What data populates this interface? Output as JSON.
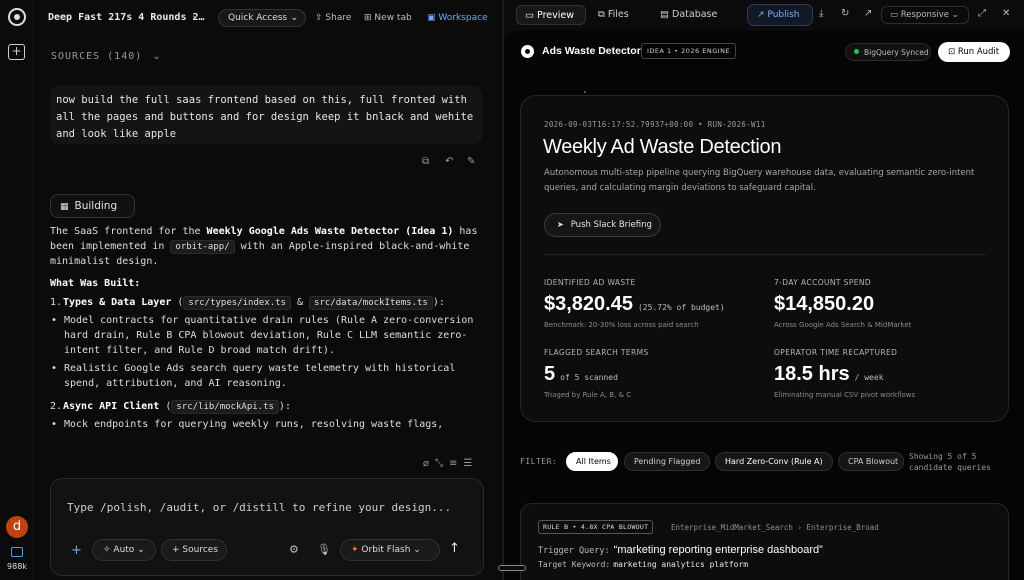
{
  "left_rail": {
    "avatar_letter": "d",
    "credits": "988k"
  },
  "chat_header": {
    "project_title": "Deep Fast 217s 4 Rounds 2…",
    "quick_access": "Quick Access",
    "share": "Share",
    "new_tab": "New tab",
    "workspace": "Workspace"
  },
  "sources": {
    "label": "SOURCES (140)"
  },
  "user_message": "now build the full saas frontend based on this, full fronted with all the pages and buttons and for design keep it bnlack and wehite and look like apple",
  "assistant": {
    "status_chip": "Building",
    "intro_1": "The SaaS frontend for the ",
    "intro_bold": "Weekly Google Ads Waste Detector (Idea 1)",
    "intro_2": " has been implemented in ",
    "intro_code": "orbit-app/",
    "intro_3": " with an Apple-inspired black-and-white minimalist design.",
    "section_heading": "What Was Built:",
    "items": [
      {
        "num": "1.",
        "title": "Types & Data Layer",
        "open": " (",
        "code1": "src/types/index.ts",
        "amp": " & ",
        "code2": "src/data/mockItems.ts",
        "close": "):",
        "bullets": [
          "Model contracts for quantitative drain rules (Rule A zero-conversion hard drain, Rule B CPA blowout deviation, Rule C LLM semantic zero-intent filter, and Rule D broad match drift).",
          "Realistic Google Ads search query waste telemetry with historical spend, attribution, and AI reasoning."
        ]
      },
      {
        "num": "2.",
        "title": "Async API Client",
        "open": " (",
        "code1": "src/lib/mockApi.ts",
        "close": "):",
        "bullets": [
          "Mock endpoints for querying weekly runs, resolving waste flags,"
        ]
      }
    ]
  },
  "composer": {
    "placeholder": "Type /polish, /audit, or /distill to refine your design...",
    "mode": "Auto",
    "sources_btn": "Sources",
    "model": "Orbit Flash"
  },
  "preview_toolbar": {
    "tabs": [
      "Preview",
      "Files",
      "Database"
    ],
    "publish": "Publish",
    "viewport": "Responsive"
  },
  "app": {
    "brand": "Ads Waste Detector",
    "engine_badge": "IDEA 1 • 2026 ENGINE",
    "sync_status": "BigQuery Synced",
    "run_audit": "Run Audit",
    "hero": {
      "run_meta": "2026-09-03T16:17:52.79937+00:00 • RUN-2026-W11",
      "title": "Weekly Ad Waste Detection",
      "description": "Autonomous multi-step pipeline querying BigQuery warehouse data, evaluating semantic zero-intent queries, and calculating margin deviations to safeguard capital.",
      "push_button": "Push Slack Briefing"
    },
    "stats": [
      {
        "label": "IDENTIFIED AD WASTE",
        "value": "$3,820.45",
        "suffix": "(25.72% of budget)",
        "note": "Benchmark: 20-30% loss across paid search"
      },
      {
        "label": "7-DAY ACCOUNT SPEND",
        "value": "$14,850.20",
        "suffix": "",
        "note": "Across Google Ads Search & MidMarket"
      },
      {
        "label": "FLAGGED SEARCH TERMS",
        "value": "5",
        "suffix": "of 5 scanned",
        "note": "Triaged by Rule A, B, & C"
      },
      {
        "label": "OPERATOR TIME RECAPTURED",
        "value": "18.5 hrs",
        "suffix": "/ week",
        "note": "Eliminating manual CSV pivot workflows"
      }
    ],
    "filter": {
      "label": "FILTER:",
      "chips": [
        "All Items",
        "Pending Flagged",
        "Hard Zero-Conv (Rule A)",
        "CPA Blowout"
      ],
      "active": "All Items",
      "showing": "Showing 5 of 5 candidate queries"
    },
    "query_card": {
      "rule_badge": "RULE B • 4.8X CPA BLOWOUT",
      "campaign_path": "Enterprise_MidMarket_Search › Enterprise_Broad",
      "trigger_label": "Trigger Query:",
      "trigger_query": "“marketing reporting enterprise dashboard”",
      "keyword_label": "Target Keyword:",
      "keyword": "marketing analytics platform"
    }
  }
}
